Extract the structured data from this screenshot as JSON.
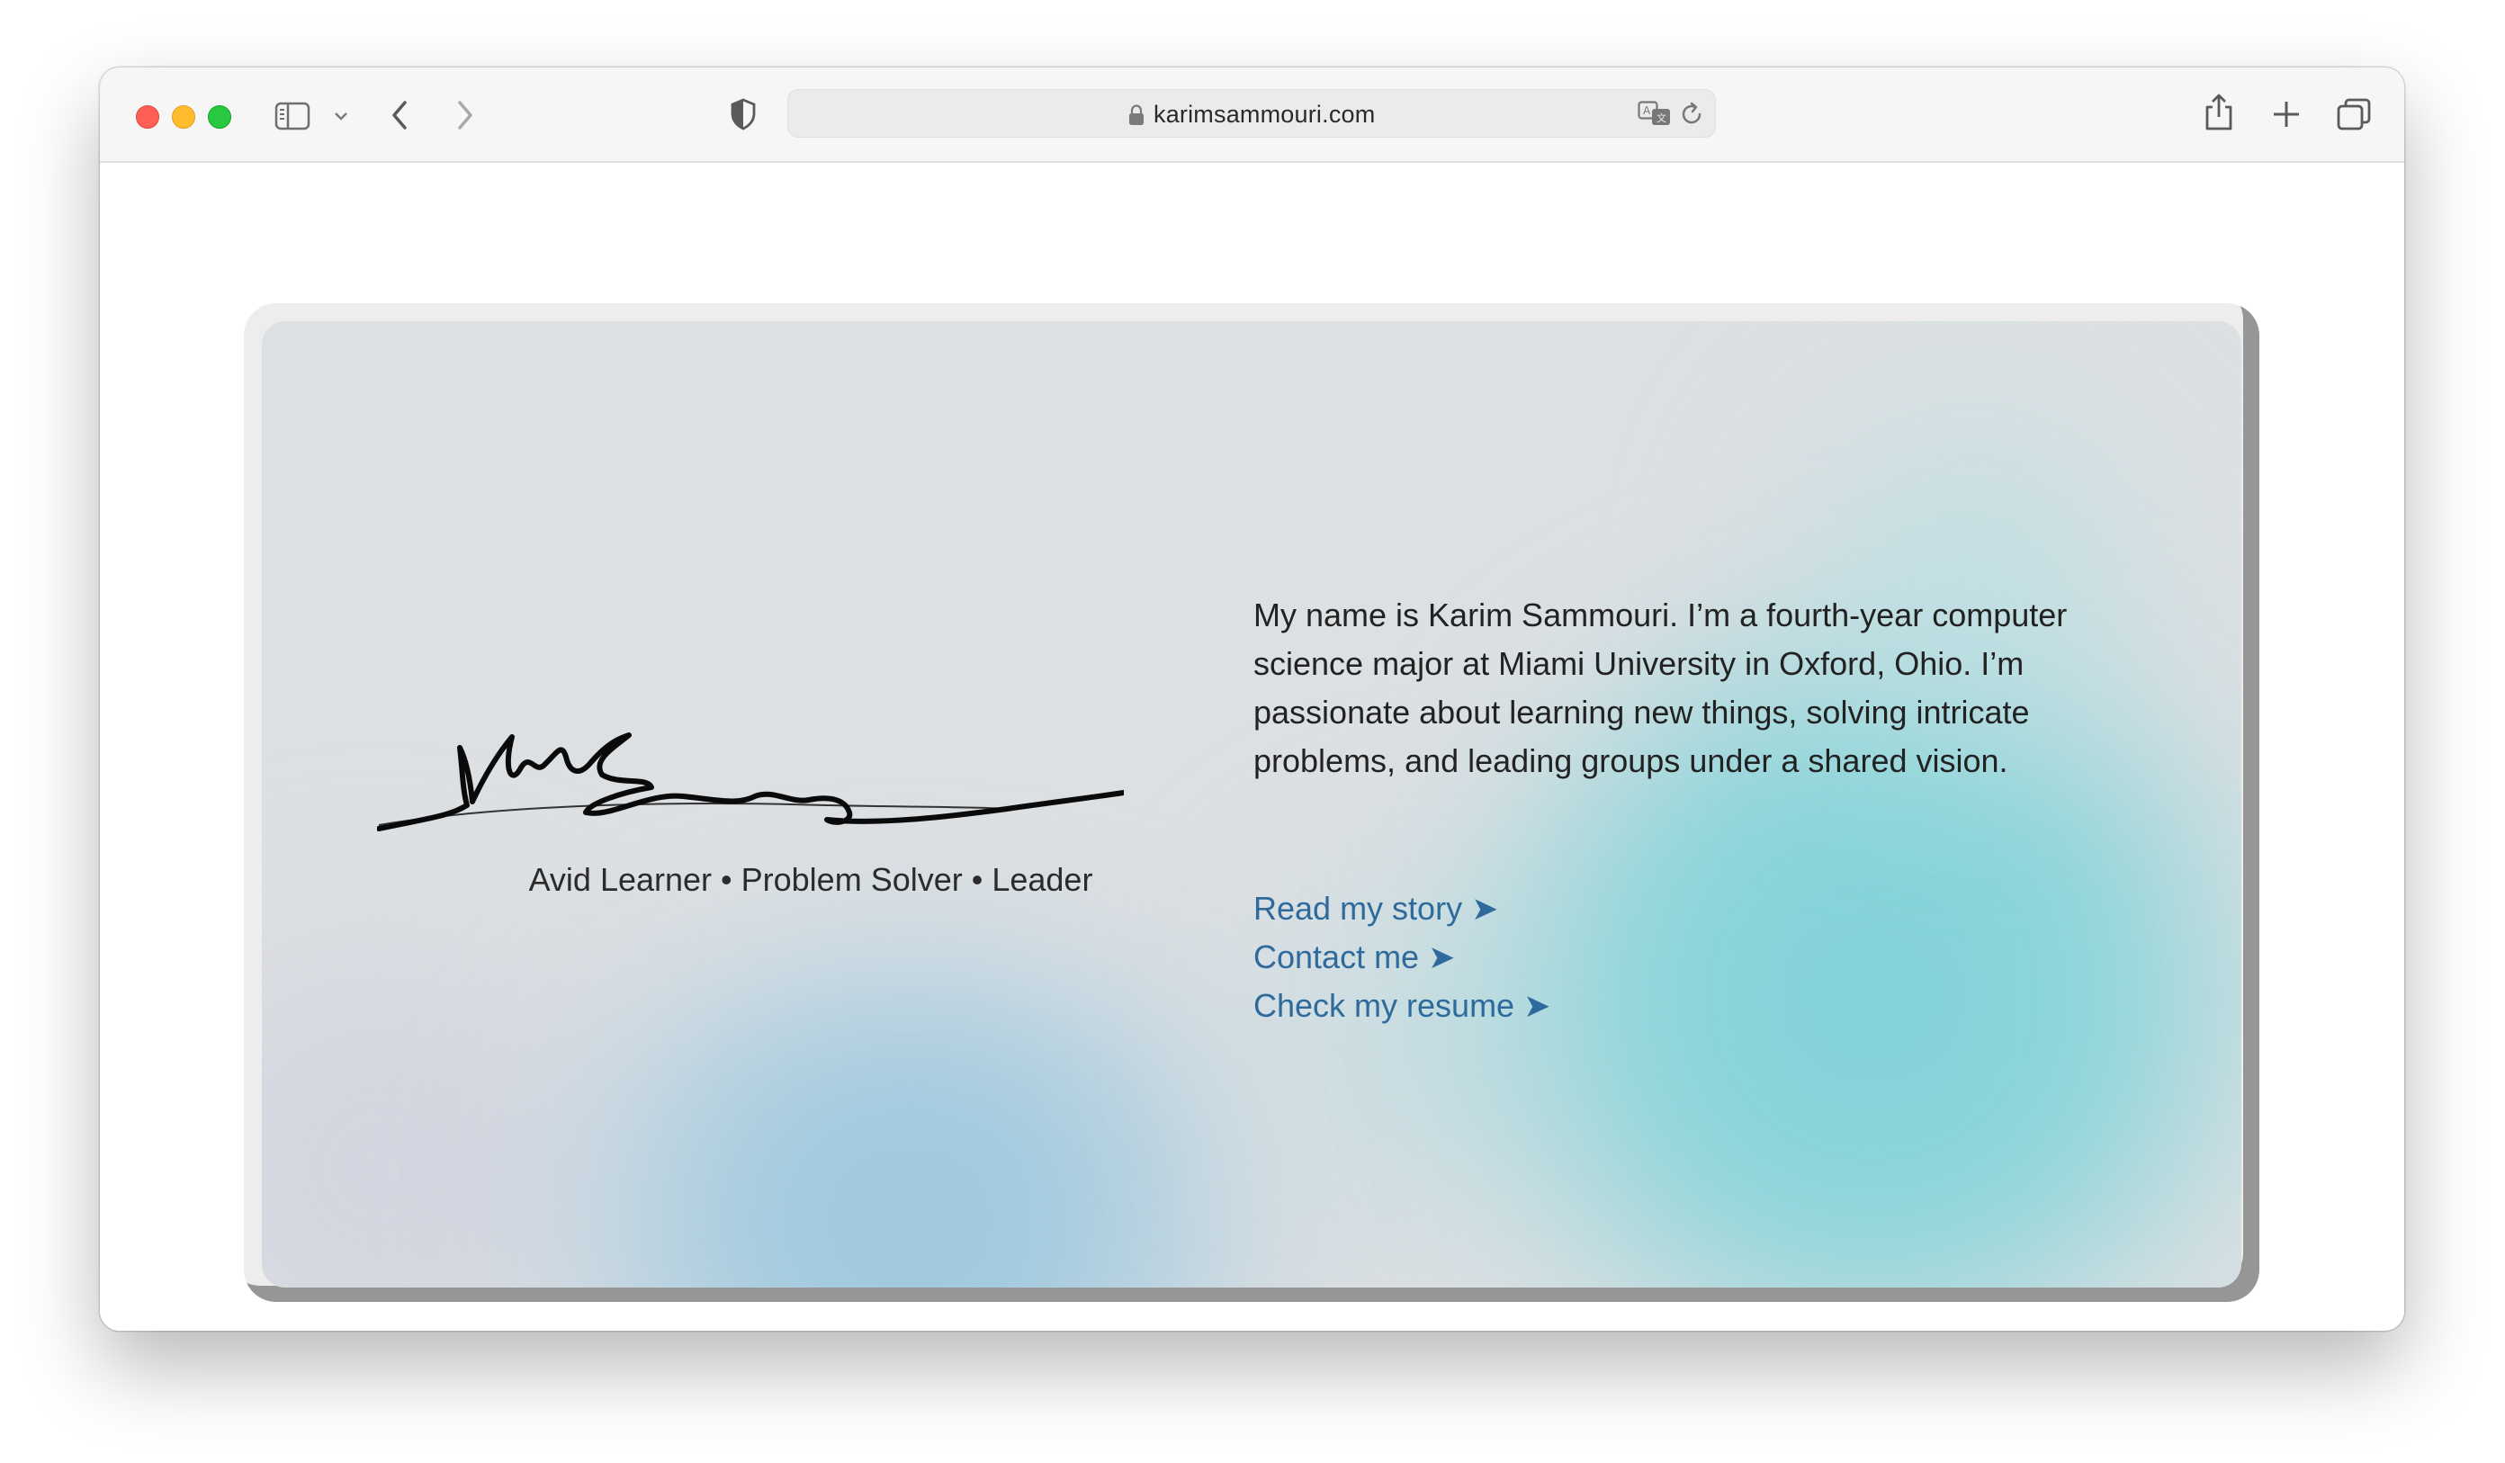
{
  "browser": {
    "url": "karimsammouri.com",
    "icons": {
      "close": "red-traffic-light",
      "minimize": "yellow-traffic-light",
      "zoom": "green-traffic-light",
      "sidebar": "sidebar-icon",
      "sidebar_menu": "chevron-down-icon",
      "back": "chevron-left-icon",
      "forward": "chevron-right-icon",
      "privacy": "shield-icon",
      "lock": "lock-icon",
      "translate": "translate-icon",
      "reload": "reload-icon",
      "share": "share-icon",
      "new_tab": "plus-icon",
      "tabs": "tab-overview-icon"
    }
  },
  "hero": {
    "signature": "handwritten-signature",
    "tagline": "Avid Learner • Problem Solver • Leader",
    "bio": "My name is Karim Sammouri. I’m a fourth-year computer science major at Miami University in Oxford, Ohio. I’m passionate about learning new things, solving intricate problems, and leading groups under a shared vision.",
    "links": [
      {
        "label": "Read my story ➤"
      },
      {
        "label": "Contact me ➤"
      },
      {
        "label": "Check my resume ➤"
      }
    ],
    "colors": {
      "link": "#2f6a9c",
      "text": "#222222",
      "background": "#dde0e3",
      "teal": "#7fd2d8",
      "blue": "#98c5dd",
      "frame_shadow": "#969696"
    }
  }
}
